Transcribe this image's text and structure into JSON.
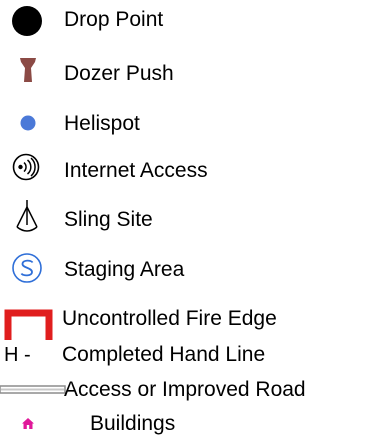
{
  "legend": {
    "items": [
      {
        "label": "Drop Point",
        "icon": "filled-circle-icon",
        "color": "#000000"
      },
      {
        "label": "Dozer Push",
        "icon": "dozer-push-icon",
        "color": "#8B4A45"
      },
      {
        "label": "Helispot",
        "icon": "blue-dot-icon",
        "color": "#4B79D8"
      },
      {
        "label": "Internet Access",
        "icon": "wireless-signal-icon",
        "color": "#000000"
      },
      {
        "label": "Sling Site",
        "icon": "sling-tripod-icon",
        "color": "#000000"
      },
      {
        "label": "Staging Area",
        "icon": "staging-s-circle-icon",
        "color": "#2F6FD8"
      },
      {
        "label": "Uncontrolled Fire Edge",
        "icon": "fire-edge-bracket-icon",
        "color": "#E01E1E"
      },
      {
        "label": "Completed Hand Line",
        "icon": "hand-line-icon",
        "color": "#000000",
        "symbol_text": "H -"
      },
      {
        "label": "Access or Improved Road",
        "icon": "road-double-line-icon",
        "color": "#8C8C8C"
      },
      {
        "label": "Buildings",
        "icon": "building-house-icon",
        "color": "#E0189A"
      }
    ]
  }
}
